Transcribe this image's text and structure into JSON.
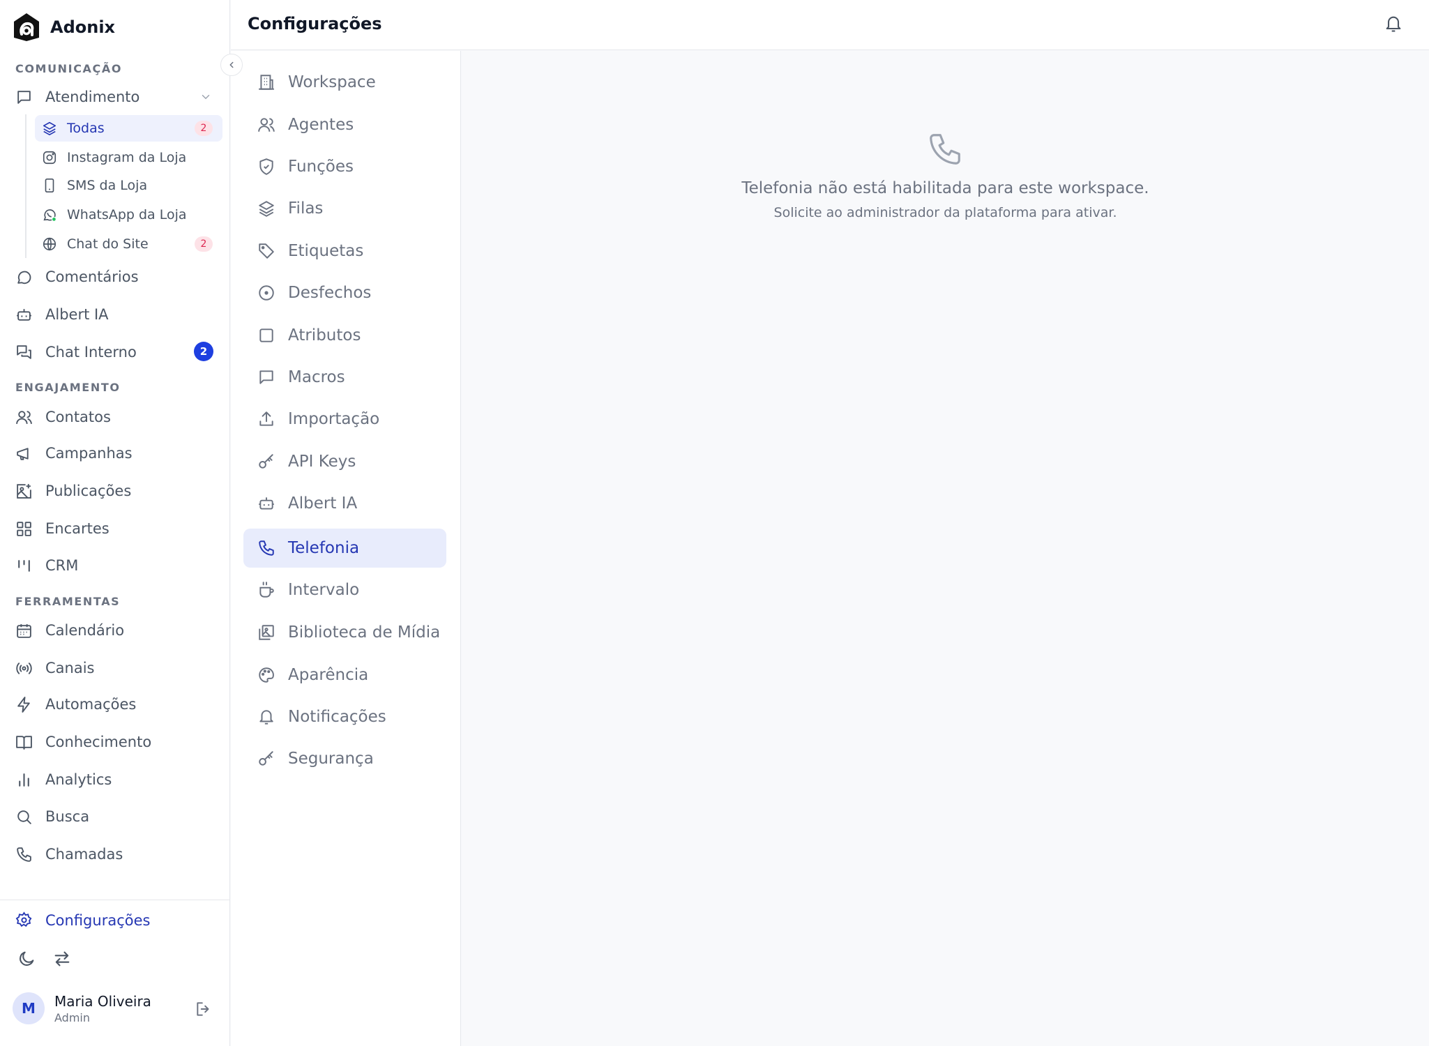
{
  "app": {
    "name": "Adonix"
  },
  "header": {
    "title": "Configurações"
  },
  "sidebar": {
    "sections": {
      "comunicacao": "COMUNICAÇÃO",
      "engajamento": "ENGAJAMENTO",
      "ferramentas": "FERRAMENTAS"
    },
    "atendimento": {
      "label": "Atendimento",
      "children": [
        {
          "label": "Todas",
          "badge": "2",
          "icon": "layers-icon"
        },
        {
          "label": "Instagram da Loja",
          "icon": "instagram-icon"
        },
        {
          "label": "SMS da Loja",
          "icon": "smartphone-icon"
        },
        {
          "label": "WhatsApp da Loja",
          "icon": "whatsapp-icon"
        },
        {
          "label": "Chat do Site",
          "badge": "2",
          "icon": "globe-icon"
        }
      ]
    },
    "items": {
      "comentarios": "Comentários",
      "albert": "Albert IA",
      "chat_interno": "Chat Interno",
      "chat_interno_badge": "2",
      "contatos": "Contatos",
      "campanhas": "Campanhas",
      "publicacoes": "Publicações",
      "encartes": "Encartes",
      "crm": "CRM",
      "calendario": "Calendário",
      "canais": "Canais",
      "automacoes": "Automações",
      "conhecimento": "Conhecimento",
      "analytics": "Analytics",
      "busca": "Busca",
      "chamadas": "Chamadas"
    },
    "settings_label": "Configurações",
    "user": {
      "initial": "M",
      "name": "Maria Oliveira",
      "role": "Admin"
    }
  },
  "settings_menu": [
    {
      "label": "Workspace",
      "icon": "building-icon"
    },
    {
      "label": "Agentes",
      "icon": "users-icon"
    },
    {
      "label": "Funções",
      "icon": "shield-check-icon"
    },
    {
      "label": "Filas",
      "icon": "layers-icon"
    },
    {
      "label": "Etiquetas",
      "icon": "tag-icon"
    },
    {
      "label": "Desfechos",
      "icon": "circle-dot-icon"
    },
    {
      "label": "Atributos",
      "icon": "square-icon"
    },
    {
      "label": "Macros",
      "icon": "message-square-icon"
    },
    {
      "label": "Importação",
      "icon": "upload-icon"
    },
    {
      "label": "API Keys",
      "icon": "key-icon"
    },
    {
      "label": "Albert IA",
      "icon": "bot-icon"
    },
    {
      "label": "Telefonia",
      "icon": "phone-icon",
      "active": true
    },
    {
      "label": "Intervalo",
      "icon": "coffee-icon"
    },
    {
      "label": "Biblioteca de Mídia",
      "icon": "images-icon"
    },
    {
      "label": "Aparência",
      "icon": "palette-icon"
    },
    {
      "label": "Notificações",
      "icon": "bell-icon"
    },
    {
      "label": "Segurança",
      "icon": "key-icon"
    }
  ],
  "content": {
    "title": "Telefonia não está habilitada para este workspace.",
    "subtitle": "Solicite ao administrador da plataforma para ativar."
  },
  "colors": {
    "accent": "#2537b3",
    "active_bg": "#e8ecfc",
    "badge_blue": "#1e3fe0",
    "badge_pink_text": "#dc2650"
  }
}
